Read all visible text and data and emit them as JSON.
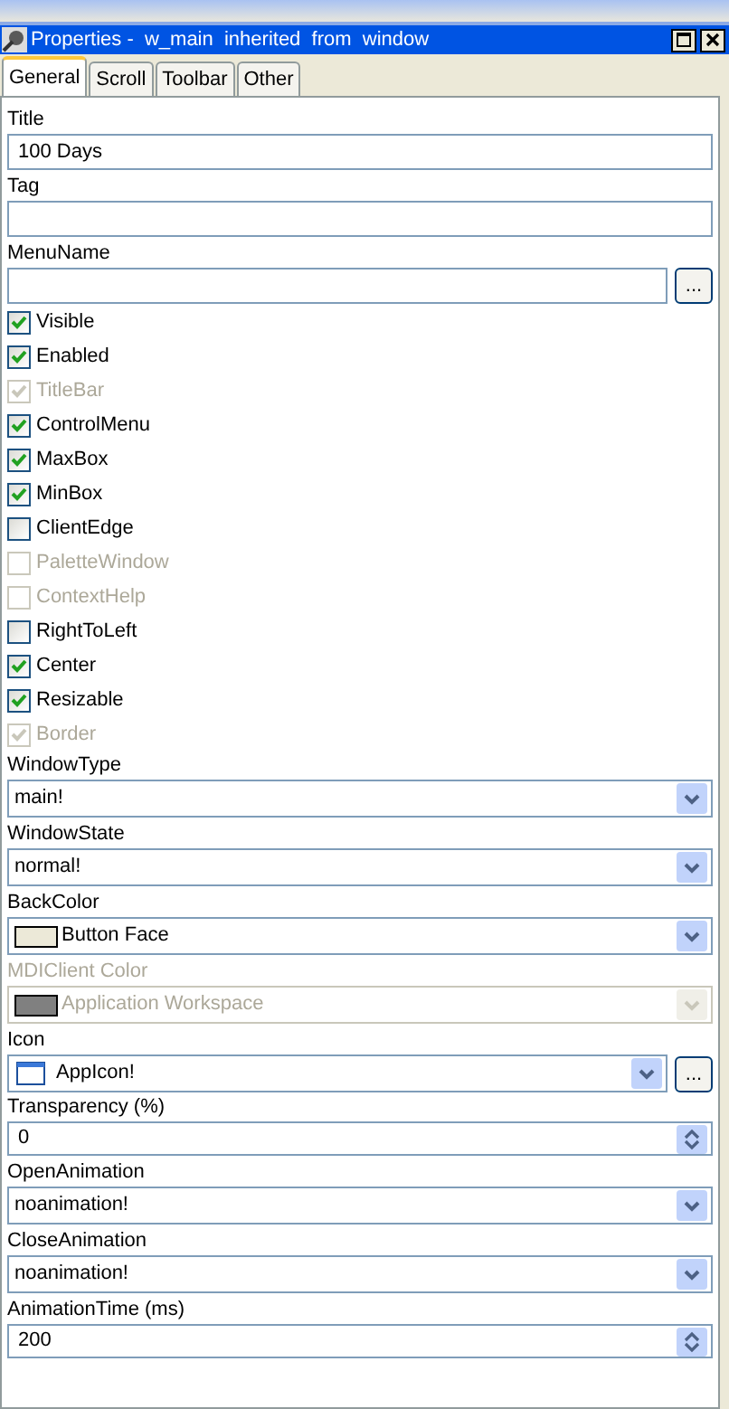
{
  "window": {
    "title": "Properties -  w_main  inherited  from  window"
  },
  "tabs": [
    {
      "label": "General",
      "selected": true
    },
    {
      "label": "Scroll",
      "selected": false
    },
    {
      "label": "Toolbar",
      "selected": false
    },
    {
      "label": "Other",
      "selected": false
    }
  ],
  "fields": [
    {
      "kind": "text",
      "label": "Title",
      "value": "100 Days"
    },
    {
      "kind": "text",
      "label": "Tag"
    },
    {
      "kind": "text_button",
      "label": "MenuName",
      "button": "..."
    },
    {
      "kind": "checkbox",
      "label": "Visible",
      "checked": true,
      "disabled": false
    },
    {
      "kind": "checkbox",
      "label": "Enabled",
      "checked": true,
      "disabled": false
    },
    {
      "kind": "checkbox",
      "label": "TitleBar",
      "checked": true,
      "disabled": true
    },
    {
      "kind": "checkbox",
      "label": "ControlMenu",
      "checked": true,
      "disabled": false
    },
    {
      "kind": "checkbox",
      "label": "MaxBox",
      "checked": true,
      "disabled": false
    },
    {
      "kind": "checkbox",
      "label": "MinBox",
      "checked": true,
      "disabled": false
    },
    {
      "kind": "checkbox",
      "label": "ClientEdge",
      "checked": false,
      "disabled": false
    },
    {
      "kind": "checkbox",
      "label": "PaletteWindow",
      "checked": false,
      "disabled": true
    },
    {
      "kind": "checkbox",
      "label": "ContextHelp",
      "checked": false,
      "disabled": true
    },
    {
      "kind": "checkbox",
      "label": "RightToLeft",
      "checked": false,
      "disabled": false
    },
    {
      "kind": "checkbox",
      "label": "Center",
      "checked": true,
      "disabled": false
    },
    {
      "kind": "checkbox",
      "label": "Resizable",
      "checked": true,
      "disabled": false
    },
    {
      "kind": "checkbox",
      "label": "Border",
      "checked": true,
      "disabled": true
    },
    {
      "kind": "dropdown",
      "label": "WindowType",
      "value": "main!",
      "disabled": false
    },
    {
      "kind": "dropdown",
      "label": "WindowState",
      "value": "normal!",
      "disabled": false
    },
    {
      "kind": "color_dropdown",
      "label": "BackColor",
      "value": "Button Face",
      "color": "#ece9d8",
      "disabled": false
    },
    {
      "kind": "color_dropdown",
      "label": "MDIClient Color",
      "value": "Application Workspace",
      "color": "#808080",
      "disabled": true
    },
    {
      "kind": "icon_dropdown",
      "label": "Icon",
      "value": "AppIcon!",
      "button": "..."
    },
    {
      "kind": "spin",
      "label": "Transparency (%)",
      "value": "0"
    },
    {
      "kind": "dropdown",
      "label": "OpenAnimation",
      "value": "noanimation!",
      "disabled": false
    },
    {
      "kind": "dropdown",
      "label": "CloseAnimation",
      "value": "noanimation!",
      "disabled": false
    },
    {
      "kind": "spin",
      "label": "AnimationTime (ms)",
      "value": "200"
    }
  ]
}
